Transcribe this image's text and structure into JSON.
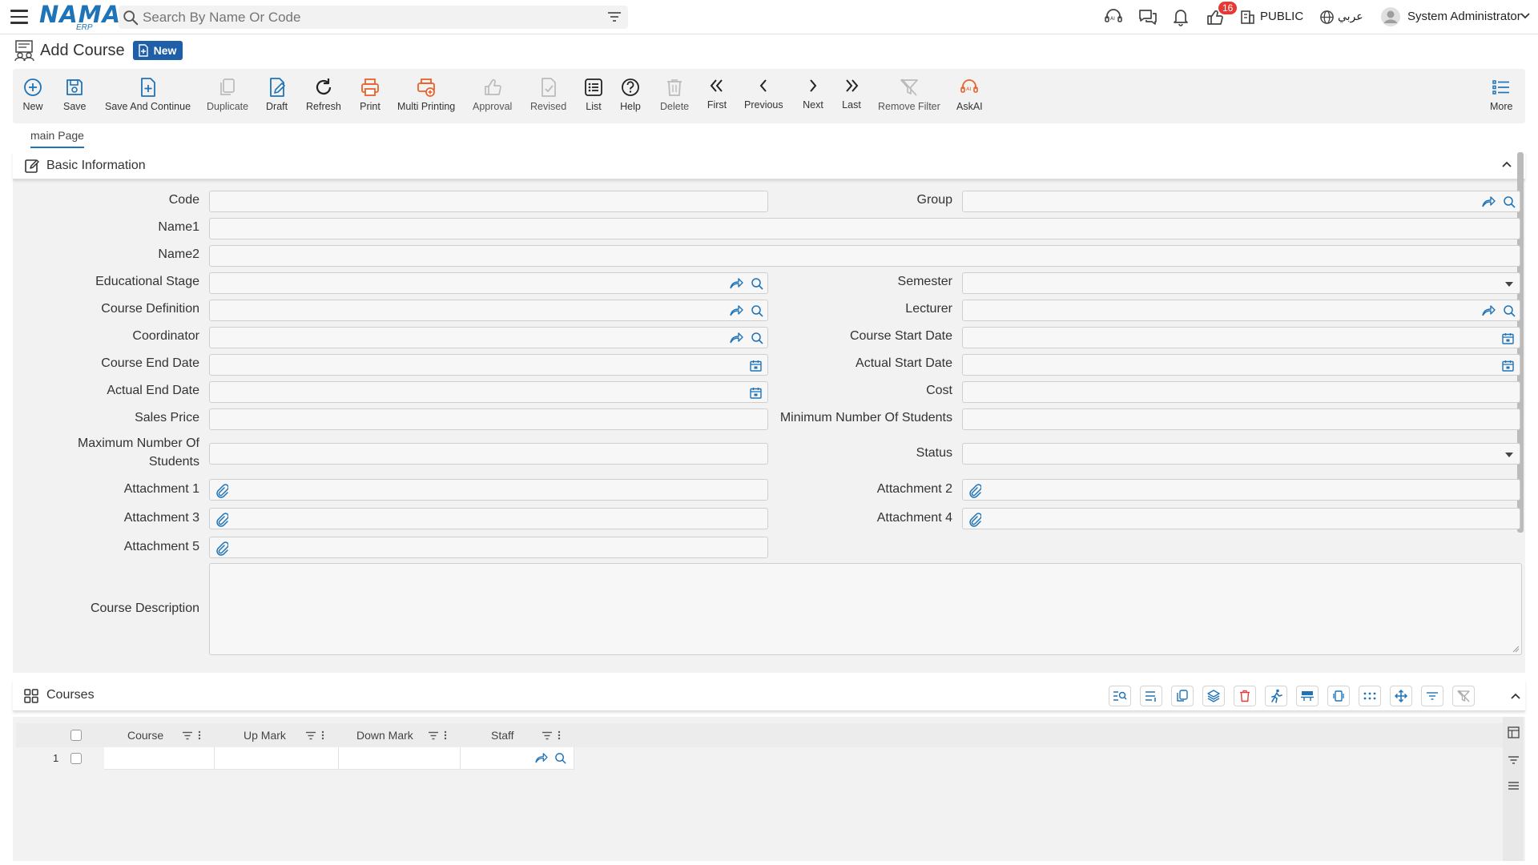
{
  "header": {
    "logo_text": "NAMA",
    "logo_sub": "ERP",
    "search_placeholder": "Search By Name Or Code",
    "notification_count": "16",
    "public_label": "PUBLIC",
    "language_label": "عربي",
    "user_name": "System Administrator"
  },
  "page": {
    "title": "Add Course",
    "status_badge": "New"
  },
  "toolbar": {
    "buttons": [
      {
        "label": "New",
        "icon": "plus-circle-icon"
      },
      {
        "label": "Save",
        "icon": "save-icon"
      },
      {
        "label": "Save And Continue",
        "icon": "save-continue-icon"
      },
      {
        "label": "Duplicate",
        "icon": "duplicate-icon"
      },
      {
        "label": "Draft",
        "icon": "draft-icon"
      },
      {
        "label": "Refresh",
        "icon": "refresh-icon"
      },
      {
        "label": "Print",
        "icon": "print-icon"
      },
      {
        "label": "Multi Printing",
        "icon": "multi-print-icon"
      },
      {
        "label": "Approval",
        "icon": "thumb-up-icon"
      },
      {
        "label": "Revised",
        "icon": "revised-icon"
      },
      {
        "label": "List",
        "icon": "list-icon"
      },
      {
        "label": "Help",
        "icon": "help-icon"
      },
      {
        "label": "Delete",
        "icon": "trash-icon"
      },
      {
        "label": "First",
        "icon": "first-icon"
      },
      {
        "label": "Previous",
        "icon": "previous-icon"
      },
      {
        "label": "Next",
        "icon": "next-icon"
      },
      {
        "label": "Last",
        "icon": "last-icon"
      },
      {
        "label": "Remove Filter",
        "icon": "remove-filter-icon"
      },
      {
        "label": "AskAI",
        "icon": "askai-icon"
      },
      {
        "label": "More",
        "icon": "more-list-icon"
      }
    ]
  },
  "tabs": {
    "main": "main Page"
  },
  "basic_info": {
    "title": "Basic Information",
    "fields": {
      "code": "Code",
      "group": "Group",
      "name1": "Name1",
      "name2": "Name2",
      "educational_stage": "Educational Stage",
      "semester": "Semester",
      "course_definition": "Course Definition",
      "lecturer": "Lecturer",
      "coordinator": "Coordinator",
      "course_start_date": "Course Start Date",
      "course_end_date": "Course End Date",
      "actual_start_date": "Actual Start Date",
      "actual_end_date": "Actual End Date",
      "cost": "Cost",
      "sales_price": "Sales Price",
      "minimum_students": "Minimum Number Of Students",
      "maximum_students_1": "Maximum Number Of",
      "maximum_students_2": "Students",
      "status": "Status",
      "attachment_1": "Attachment 1",
      "attachment_2": "Attachment 2",
      "attachment_3": "Attachment 3",
      "attachment_4": "Attachment 4",
      "attachment_5": "Attachment 5",
      "course_description": "Course Description"
    }
  },
  "courses_grid": {
    "title": "Courses",
    "columns": [
      "Course",
      "Up Mark",
      "Down Mark",
      "Staff"
    ],
    "rows": [
      {
        "num": "1"
      }
    ]
  },
  "colors": {
    "brand_blue": "#1f73b7",
    "print_orange": "#e8622a",
    "delete_red": "#e53935",
    "panel_bg": "#f2f2f2"
  }
}
